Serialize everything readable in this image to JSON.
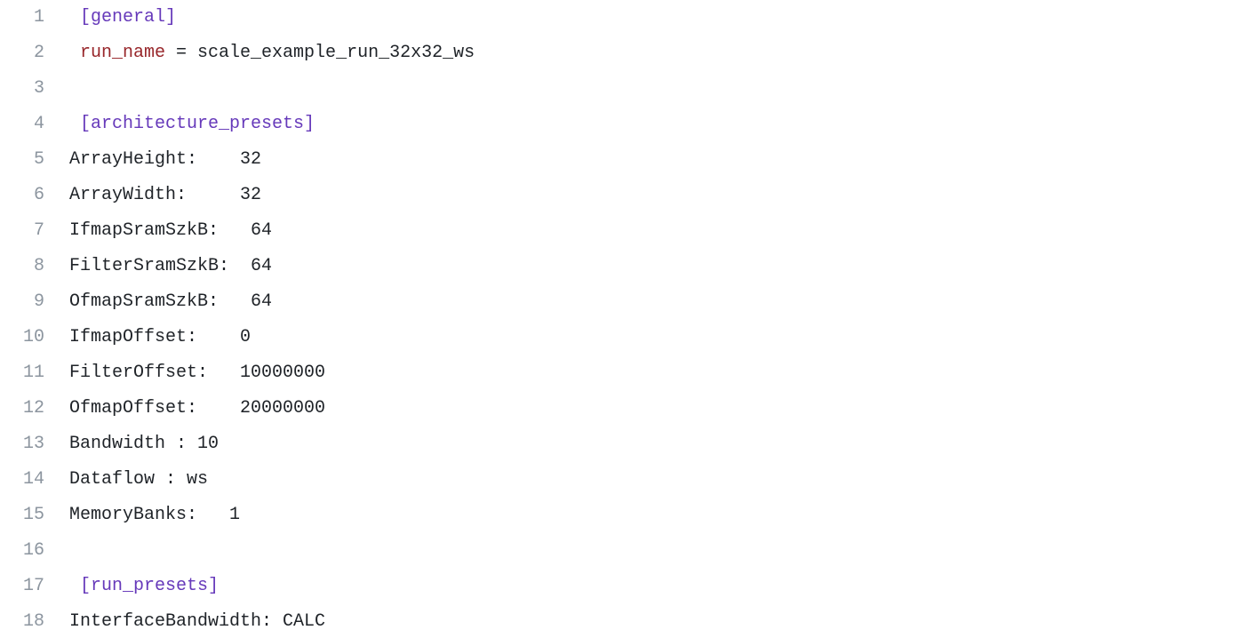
{
  "lines": [
    {
      "num": "1",
      "segments": [
        {
          "t": " ",
          "c": "plain"
        },
        {
          "t": "[general]",
          "c": "section"
        }
      ]
    },
    {
      "num": "2",
      "segments": [
        {
          "t": " ",
          "c": "plain"
        },
        {
          "t": "run_name",
          "c": "key"
        },
        {
          "t": " = scale_example_run_32x32_ws",
          "c": "plain"
        }
      ]
    },
    {
      "num": "3",
      "segments": [
        {
          "t": "",
          "c": "plain"
        }
      ]
    },
    {
      "num": "4",
      "segments": [
        {
          "t": " ",
          "c": "plain"
        },
        {
          "t": "[architecture_presets]",
          "c": "section"
        }
      ]
    },
    {
      "num": "5",
      "segments": [
        {
          "t": "ArrayHeight:    32",
          "c": "plain"
        }
      ]
    },
    {
      "num": "6",
      "segments": [
        {
          "t": "ArrayWidth:     32",
          "c": "plain"
        }
      ]
    },
    {
      "num": "7",
      "segments": [
        {
          "t": "IfmapSramSzkB:   64",
          "c": "plain"
        }
      ]
    },
    {
      "num": "8",
      "segments": [
        {
          "t": "FilterSramSzkB:  64",
          "c": "plain"
        }
      ]
    },
    {
      "num": "9",
      "segments": [
        {
          "t": "OfmapSramSzkB:   64",
          "c": "plain"
        }
      ]
    },
    {
      "num": "10",
      "segments": [
        {
          "t": "IfmapOffset:    0",
          "c": "plain"
        }
      ]
    },
    {
      "num": "11",
      "segments": [
        {
          "t": "FilterOffset:   10000000",
          "c": "plain"
        }
      ]
    },
    {
      "num": "12",
      "segments": [
        {
          "t": "OfmapOffset:    20000000",
          "c": "plain"
        }
      ]
    },
    {
      "num": "13",
      "segments": [
        {
          "t": "Bandwidth : 10",
          "c": "plain"
        }
      ]
    },
    {
      "num": "14",
      "segments": [
        {
          "t": "Dataflow : ws",
          "c": "plain"
        }
      ]
    },
    {
      "num": "15",
      "segments": [
        {
          "t": "MemoryBanks:   1",
          "c": "plain"
        }
      ]
    },
    {
      "num": "16",
      "segments": [
        {
          "t": "",
          "c": "plain"
        }
      ]
    },
    {
      "num": "17",
      "segments": [
        {
          "t": " ",
          "c": "plain"
        },
        {
          "t": "[run_presets]",
          "c": "section"
        }
      ]
    },
    {
      "num": "18",
      "segments": [
        {
          "t": "InterfaceBandwidth: CALC",
          "c": "plain"
        }
      ]
    }
  ]
}
